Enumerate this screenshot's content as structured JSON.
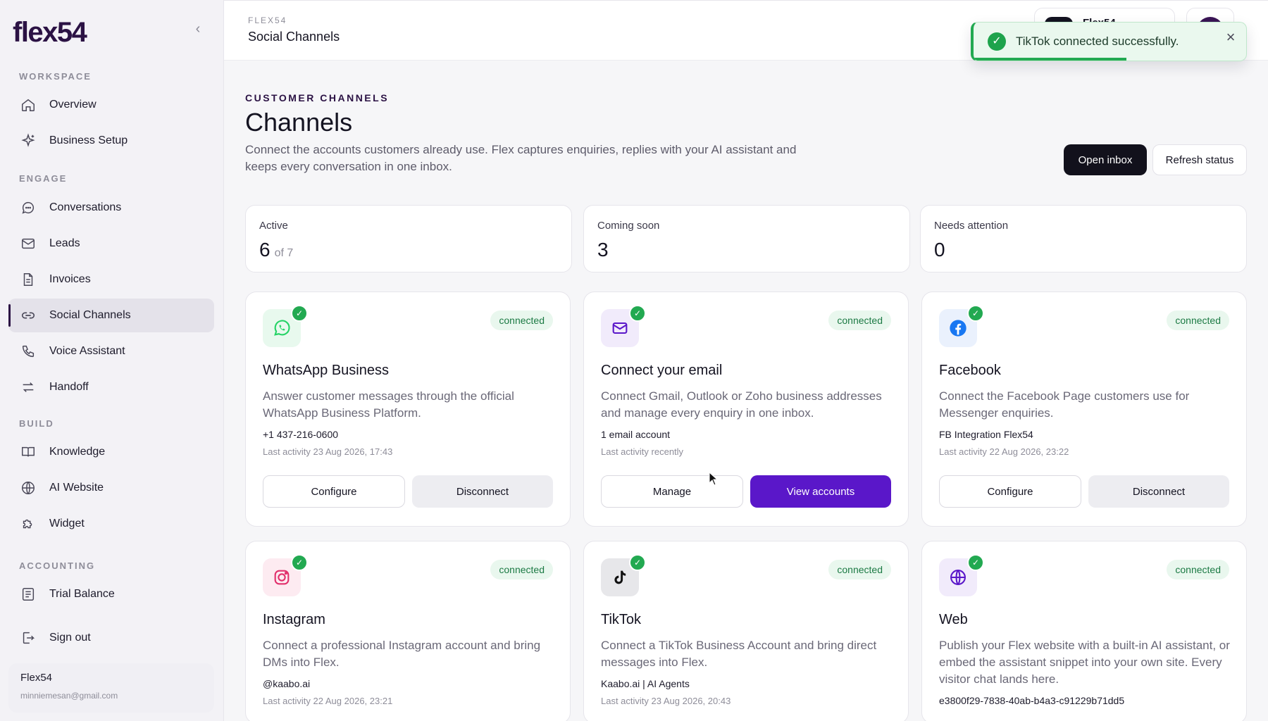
{
  "brand": {
    "logo": "flex54"
  },
  "sidebar": {
    "sections": {
      "workspace": "WORKSPACE",
      "engage": "ENGAGE",
      "build": "BUILD",
      "accounting": "ACCOUNTING"
    },
    "items": {
      "overview": "Overview",
      "business_setup": "Business Setup",
      "conversations": "Conversations",
      "leads": "Leads",
      "invoices": "Invoices",
      "social_channels": "Social Channels",
      "voice_assistant": "Voice Assistant",
      "handoff": "Handoff",
      "knowledge": "Knowledge",
      "ai_website": "AI Website",
      "widget": "Widget",
      "trial_balance": "Trial Balance",
      "sign_out": "Sign out"
    },
    "active": "social_channels",
    "user": {
      "name": "Flex54",
      "email": "minniemesan@gmail.com"
    }
  },
  "header": {
    "crumb": "FLEX54",
    "title": "Social Channels",
    "workspace_name": "Flex54"
  },
  "toast": {
    "message": "TikTok connected successfully.",
    "progress": 0.56,
    "color": "#22a951"
  },
  "page": {
    "eyebrow": "CUSTOMER CHANNELS",
    "title": "Channels",
    "description": "Connect the accounts customers already use. Flex captures enquiries, replies with your AI assistant and keeps every conversation in one inbox.",
    "open_inbox": "Open inbox",
    "refresh_status": "Refresh status"
  },
  "stats": {
    "active": {
      "label": "Active",
      "value": "6",
      "sub": "of 7"
    },
    "coming_soon": {
      "label": "Coming soon",
      "value": "3"
    },
    "needs_attention": {
      "label": "Needs attention",
      "value": "0"
    }
  },
  "channels": {
    "whatsapp": {
      "title": "WhatsApp Business",
      "status": "connected",
      "description": "Answer customer messages through the official WhatsApp Business Platform.",
      "meta": "+1 437-216-0600",
      "activity": "Last activity 23 Aug 2026, 17:43",
      "btn1": "Configure",
      "btn2": "Disconnect",
      "icon": "whatsapp-icon",
      "color": "#25d366"
    },
    "email": {
      "title": "Connect your email",
      "status": "connected",
      "description": "Connect Gmail, Outlook or Zoho business addresses and manage every enquiry in one inbox.",
      "meta": "1 email account",
      "activity": "Last activity recently",
      "btn1": "Manage",
      "btn2": "View accounts",
      "icon": "mail-icon",
      "color": "#5a17c9"
    },
    "facebook": {
      "title": "Facebook",
      "status": "connected",
      "description": "Connect the Facebook Page customers use for Messenger enquiries.",
      "meta": "FB Integration Flex54",
      "activity": "Last activity 22 Aug 2026, 23:22",
      "btn1": "Configure",
      "btn2": "Disconnect",
      "icon": "facebook-icon",
      "color": "#1877f2"
    },
    "instagram": {
      "title": "Instagram",
      "status": "connected",
      "description": "Connect a professional Instagram account and bring DMs into Flex.",
      "meta": "@kaabo.ai",
      "activity": "Last activity 22 Aug 2026, 23:21",
      "icon": "instagram-icon",
      "color": "#e1306c"
    },
    "tiktok": {
      "title": "TikTok",
      "status": "connected",
      "description": "Connect a TikTok Business Account and bring direct messages into Flex.",
      "meta": "Kaabo.ai | AI Agents",
      "activity": "Last activity 23 Aug 2026, 20:43",
      "icon": "tiktok-icon",
      "color": "#111111"
    },
    "web": {
      "title": "Web",
      "status": "connected",
      "description": "Publish your Flex website with a built-in AI assistant, or embed the assistant snippet into your own site. Every visitor chat lands here.",
      "meta": "e3800f29-7838-40ab-b4a3-c91229b71dd5",
      "icon": "globe-icon",
      "color": "#5a17c9"
    }
  }
}
